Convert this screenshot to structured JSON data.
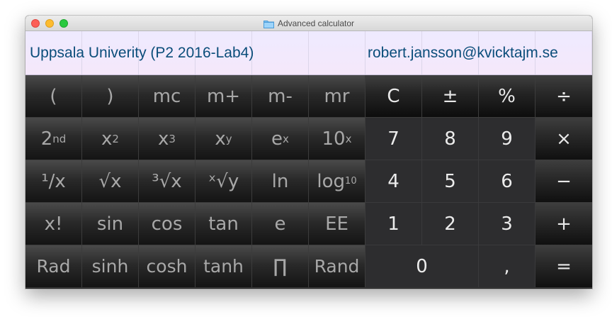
{
  "window": {
    "title": "Advanced calculator"
  },
  "info": {
    "left": "Uppsala Univerity (P2 2016-Lab4)",
    "right": "robert.jansson@kvicktajm.se"
  },
  "keys": {
    "r1": [
      "(",
      ")",
      "mc",
      "m+",
      "m-",
      "mr",
      "C",
      "±",
      "%",
      "÷"
    ],
    "r2": {
      "second_base": "2",
      "second_sup": "nd",
      "x2_base": "x",
      "x2_sup": "2",
      "x3_base": "x",
      "x3_sup": "3",
      "xy_base": "x",
      "xy_sup": "y",
      "ex_base": "e",
      "ex_sup": "x",
      "tenx_base": "10",
      "tenx_sup": "x",
      "digits": [
        "7",
        "8",
        "9"
      ],
      "op": "×"
    },
    "r3": {
      "reciprocal": "¹/x",
      "sqrt": "√x",
      "cbrt": "³√x",
      "yroot": "ˣ√y",
      "ln": "ln",
      "log_base": "log",
      "log_sub": "10",
      "digits": [
        "4",
        "5",
        "6"
      ],
      "op": "−"
    },
    "r4": [
      "x!",
      "sin",
      "cos",
      "tan",
      "e",
      "EE",
      "1",
      "2",
      "3",
      "+"
    ],
    "r5": [
      "Rad",
      "sinh",
      "cosh",
      "tanh",
      "∏",
      "Rand",
      "0",
      ",",
      "="
    ]
  },
  "colors": {
    "info_text": "#0a4d7a",
    "function_key_text": "#a8a8a8",
    "number_key_bg": "#2d2d2f"
  }
}
